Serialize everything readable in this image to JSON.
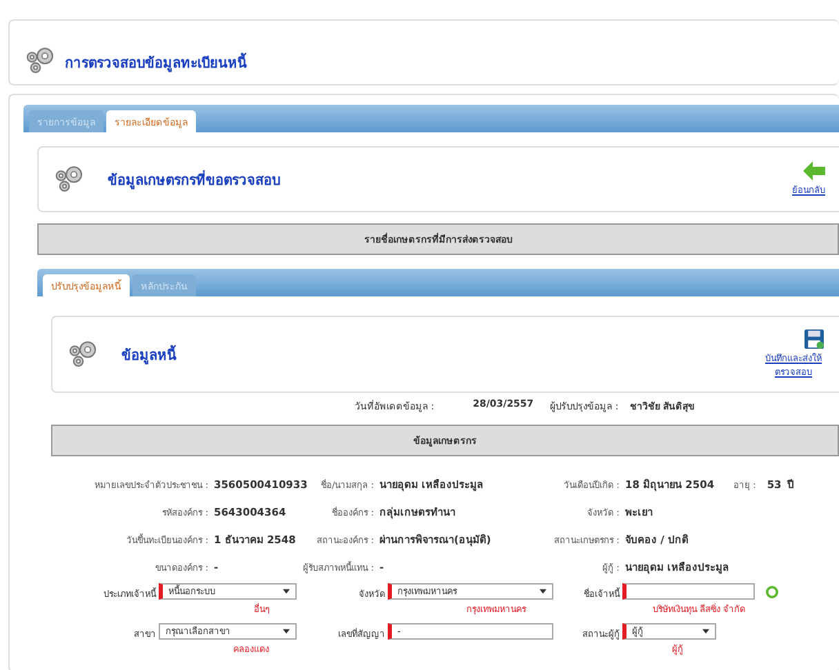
{
  "header": {
    "title": "การตรวจสอบข้อมูลทะเบียนหนี้"
  },
  "tabs": [
    {
      "label": "รายการข้อมูล",
      "selected": false
    },
    {
      "label": "รายละเอียดข้อมูล",
      "selected": true
    }
  ],
  "section": {
    "title": "ข้อมูลเกษตรกรที่ขอตรวจสอบ",
    "back_link": "ย้อนกลับ"
  },
  "list_bar": "รายชื่อเกษตรกรที่มีการส่งตรวจสอบ",
  "sub_tabs": [
    {
      "label": "ปรับปรุงข้อมูลหนี้",
      "selected": true
    },
    {
      "label": "หลักประกัน",
      "selected": false
    }
  ],
  "panel": {
    "title": "ข้อมูลหนี้",
    "save_link": "บันทึกและส่งให้ตรวจสอบ"
  },
  "update_info": {
    "date_label": "วันที่อัพเดตข้อมูล :",
    "date": "28/03/2557",
    "editor_label": "ผู้ปรับปรุงข้อมูล :",
    "editor": "ชาวิชัย  สันติสุข"
  },
  "farmer_bar": "ข้อมูลเกษตรกร",
  "info_rows": [
    {
      "pairs": [
        {
          "label": "หมายเลขประจำตัวประชาชน :",
          "value": "3560500410933"
        },
        {
          "label": "ชื่อ/นามสกุล :",
          "value": "นายอุดม เหลืองประมูล"
        },
        {
          "label": "วันเดือนปีเกิด :",
          "value": "18 มิถุนายน 2504"
        },
        {
          "label": "อายุ :",
          "value": "53"
        }
      ],
      "unit": "ปี"
    },
    {
      "pairs": [
        {
          "label": "รหัสองค์กร :",
          "value": "5643004364"
        },
        {
          "label": "ชื่อองค์กร :",
          "value": "กลุ่มเกษตรทำนา"
        },
        {
          "label": "จังหวัด :",
          "value": "พะเยา"
        }
      ]
    },
    {
      "pairs": [
        {
          "label": "วันขึ้นทะเบียนองค์กร :",
          "value": "1 ธันวาคม 2548"
        },
        {
          "label": "สถานะองค์กร :",
          "value": "ผ่านการพิจารณา(อนุมัติ)"
        },
        {
          "label": "สถานะเกษตรกร :",
          "value": "จับคอง / ปกติ"
        }
      ]
    },
    {
      "pairs": [
        {
          "label": "ขนาดองค์กร :",
          "value": "-"
        },
        {
          "label": "ผู้รับสภาพหนี้แทน :",
          "value": "-"
        },
        {
          "label": "ผู้กู้ :",
          "value": "นายอุดม เหลืองประมูล"
        }
      ]
    }
  ],
  "form_rows": [
    [
      {
        "label": "ประเภทเจ้าหนี้",
        "kind": "select",
        "value": "หนี้นอกระบบ",
        "required": true,
        "note": "อื่นๆ"
      },
      {
        "label": "จังหวัด",
        "kind": "select",
        "value": "กรุงเทพมหานคร",
        "required": true,
        "note": "กรุงเทพมหานคร"
      },
      {
        "label": "ชื่อเจ้าหนี้",
        "kind": "input",
        "required": true,
        "note": "บริษัทเงินทุน ลีสซิ่ง จำกัด",
        "action": true
      }
    ],
    [
      {
        "label": "สาขา",
        "kind": "select",
        "value": "กรุณาเลือกสาขา",
        "required": false,
        "note": "คลองแดง"
      },
      {
        "label": "เลขที่สัญญา",
        "kind": "input",
        "value": "-",
        "required": true
      },
      {
        "label": "สถานะผู้กู้",
        "kind": "select",
        "value": "ผู้กู้",
        "required": true,
        "note": "ผู้กู้"
      }
    ]
  ]
}
